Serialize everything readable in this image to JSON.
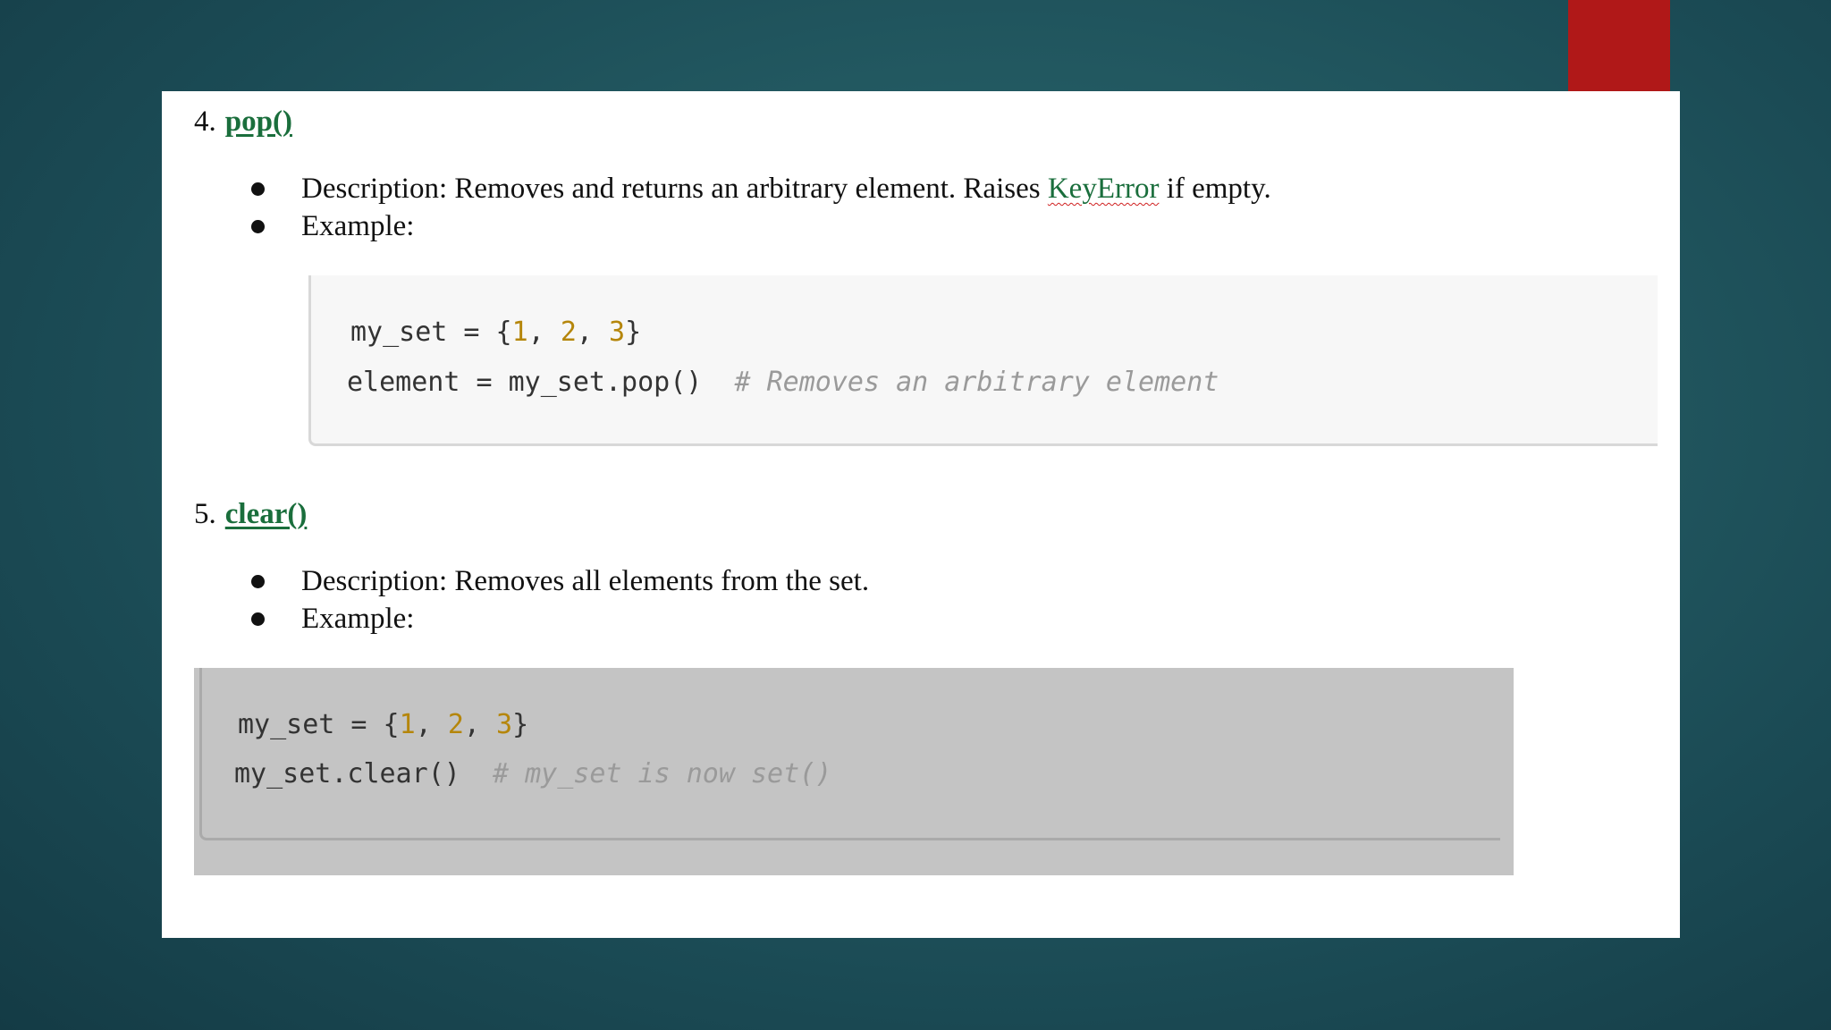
{
  "section4": {
    "number": "4.",
    "function_name": "pop()",
    "description_prefix": "Description: Removes and returns an arbitrary element. Raises ",
    "description_keyword": "KeyError",
    "description_suffix": " if empty.",
    "example_label": "Example:",
    "code": {
      "line1_prefix": "my_set = {",
      "n1": "1",
      "sep1": ", ",
      "n2": "2",
      "sep2": ", ",
      "n3": "3",
      "line1_suffix": "}",
      "line2_code": "element = my_set.pop()  ",
      "line2_comment": "# Removes an arbitrary element"
    }
  },
  "section5": {
    "number": "5.",
    "function_name": "clear()",
    "description": "Description: Removes all elements from the set.",
    "example_label": "Example:",
    "code": {
      "line1_prefix": "my_set = {",
      "n1": "1",
      "sep1": ", ",
      "n2": "2",
      "sep2": ", ",
      "n3": "3",
      "line1_suffix": "}",
      "line2_code": "my_set.clear()  ",
      "line2_comment": "# my_set is now set()"
    }
  },
  "colors": {
    "accent_bar": "#b01818",
    "link_green": "#1a6e3c",
    "number_literal": "#b5860b",
    "comment_gray": "#9a9a9a"
  }
}
